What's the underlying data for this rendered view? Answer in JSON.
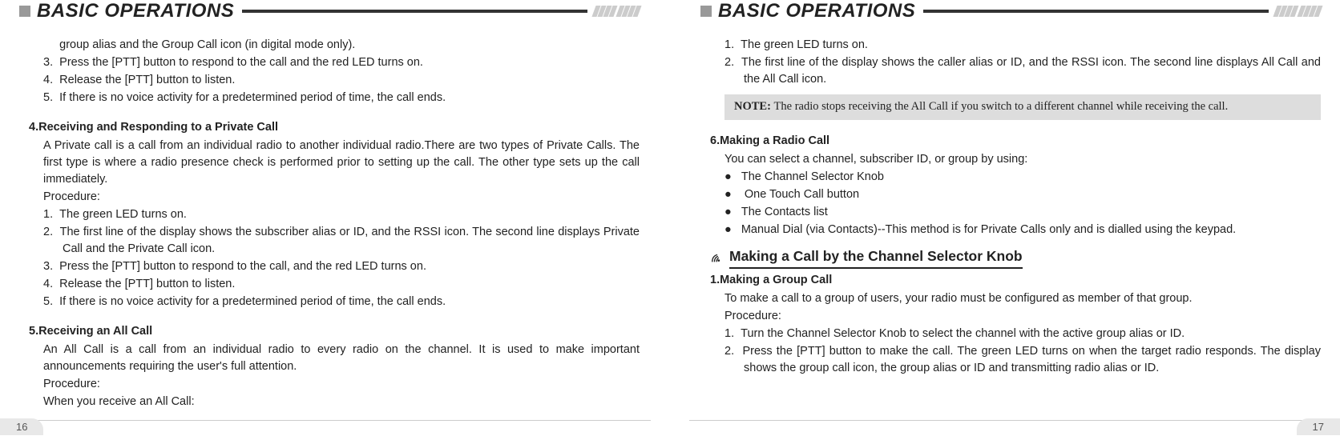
{
  "left": {
    "header": "BASIC OPERATIONS",
    "pageNum": "16",
    "topLine": "group alias and the Group Call icon (in digital mode only).",
    "items1": {
      "i3": "Press the [PTT] button to respond to the call and the red LED turns on.",
      "i4": "Release the [PTT]  button to listen.",
      "i5": "If there is no voice activity for a predetermined period of time, the call ends."
    },
    "sec4": {
      "heading": "4.Receiving and Responding to a Private Call",
      "p1": "A Private call is a call from an individual radio to another individual radio.There are two types of Private Calls. The first type is where a radio presence check is performed prior to setting up the call. The other type sets up the call immediately.",
      "p2": "Procedure:",
      "i1": "The green LED turns on.",
      "i2": "The first line of the display shows the subscriber alias or ID, and the RSSI icon. The second line displays Private Call and the Private Call icon.",
      "i3": "Press the [PTT] button to respond to the call, and the red LED turns on.",
      "i4": "Release the [PTT] button to listen.",
      "i5": "If there is no voice activity for a predetermined period of time, the call ends."
    },
    "sec5": {
      "heading": "5.Receiving an All Call",
      "p1": "An All Call is a call from an individual radio to every radio on the channel. It is used to make important  announcements requiring the user's full attention.",
      "p2": "Procedure:",
      "p3": "When you receive an All Call:"
    }
  },
  "right": {
    "header": "BASIC OPERATIONS",
    "pageNum": "17",
    "items1": {
      "i1": "The green LED turns on.",
      "i2": "The first line of the display shows the caller alias or ID, and the RSSI icon. The second line displays All Call and the All Call icon."
    },
    "noteLabel": "NOTE: ",
    "noteText": "The radio stops receiving the All Call if you switch to a different channel while receiving the call.",
    "sec6": {
      "heading": "6.Making a Radio Call",
      "p1": "You can select a channel, subscriber ID, or group by using:",
      "b1": "The Channel Selector Knob",
      "b2": " One Touch Call button",
      "b3": "The Contacts list",
      "b4": "Manual Dial (via Contacts)--This method is for Private Calls only and is dialled using the keypad."
    },
    "subsection": "Making a Call by the Channel Selector Knob",
    "sec1": {
      "heading": "1.Making a Group Call",
      "p1": "To make a call to a group of users, your radio must be configured as member of that group.",
      "p2": "Procedure:",
      "i1": "Turn the Channel Selector Knob to select the channel with the active group alias or ID.",
      "i2": "Press the [PTT] button to make the call. The green LED turns on when the target radio responds. The display shows the group call icon, the group  alias or ID and transmitting radio alias or ID."
    }
  }
}
